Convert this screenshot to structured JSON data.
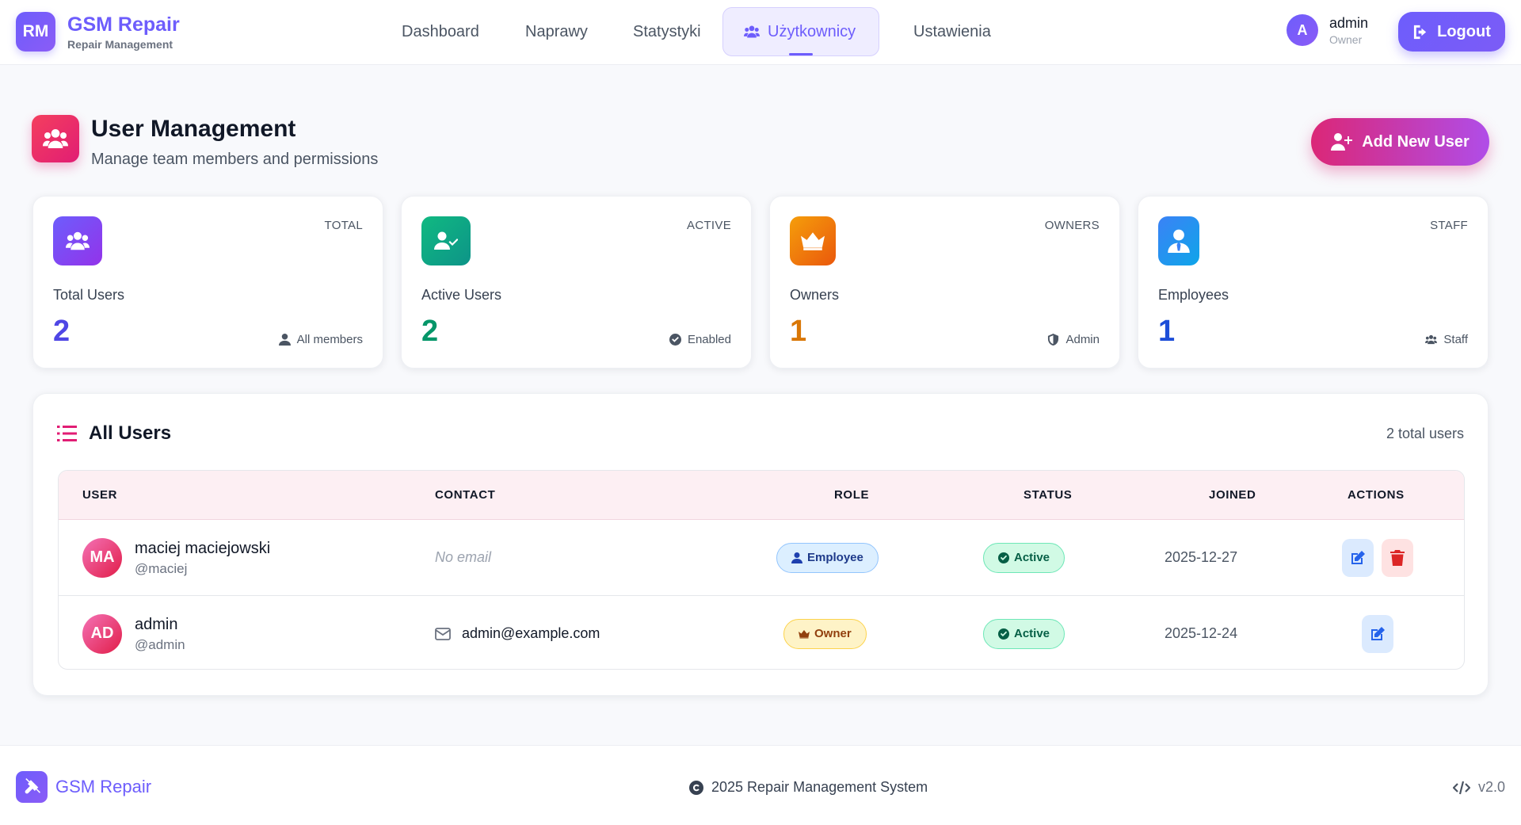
{
  "brand": {
    "initials": "RM",
    "title": "GSM Repair",
    "subtitle": "Repair Management"
  },
  "nav": [
    {
      "label": "Dashboard",
      "icon": "chart-pie-icon"
    },
    {
      "label": "Naprawy",
      "icon": "tools-icon"
    },
    {
      "label": "Statystyki",
      "icon": "chart-line-icon"
    },
    {
      "label": "Użytkownicy",
      "icon": "users-icon",
      "active": true
    },
    {
      "label": "Ustawienia",
      "icon": "gear-icon"
    }
  ],
  "current_user": {
    "initial": "A",
    "name": "admin",
    "role": "Owner"
  },
  "logout_label": "Logout",
  "page": {
    "title": "User Management",
    "subtitle": "Manage team members and permissions",
    "add_button": "Add New User"
  },
  "stats": [
    {
      "tag": "TOTAL",
      "label": "Total Users",
      "value": "2",
      "note": "All members",
      "color": "#4f46e5"
    },
    {
      "tag": "ACTIVE",
      "label": "Active Users",
      "value": "2",
      "note": "Enabled",
      "color": "#059669"
    },
    {
      "tag": "OWNERS",
      "label": "Owners",
      "value": "1",
      "note": "Admin",
      "color": "#d97706"
    },
    {
      "tag": "STAFF",
      "label": "Employees",
      "value": "1",
      "note": "Staff",
      "color": "#1d4ed8"
    }
  ],
  "users_section": {
    "title": "All Users",
    "count": "2 total users",
    "columns": [
      "USER",
      "CONTACT",
      "ROLE",
      "STATUS",
      "JOINED",
      "ACTIONS"
    ],
    "rows": [
      {
        "initials": "MA",
        "name": "maciej maciejowski",
        "handle": "@maciej",
        "contact": "No email",
        "has_email": false,
        "role": "Employee",
        "status": "Active",
        "joined": "2025-12-27",
        "can_delete": true
      },
      {
        "initials": "AD",
        "name": "admin",
        "handle": "@admin",
        "contact": "admin@example.com",
        "has_email": true,
        "role": "Owner",
        "status": "Active",
        "joined": "2025-12-24",
        "can_delete": false
      }
    ]
  },
  "footer": {
    "brand": "GSM Repair",
    "copyright": "2025 Repair Management System",
    "version": "v2.0"
  },
  "colors": {
    "accent": "#6d5dfc",
    "pink": "#e11d74"
  }
}
